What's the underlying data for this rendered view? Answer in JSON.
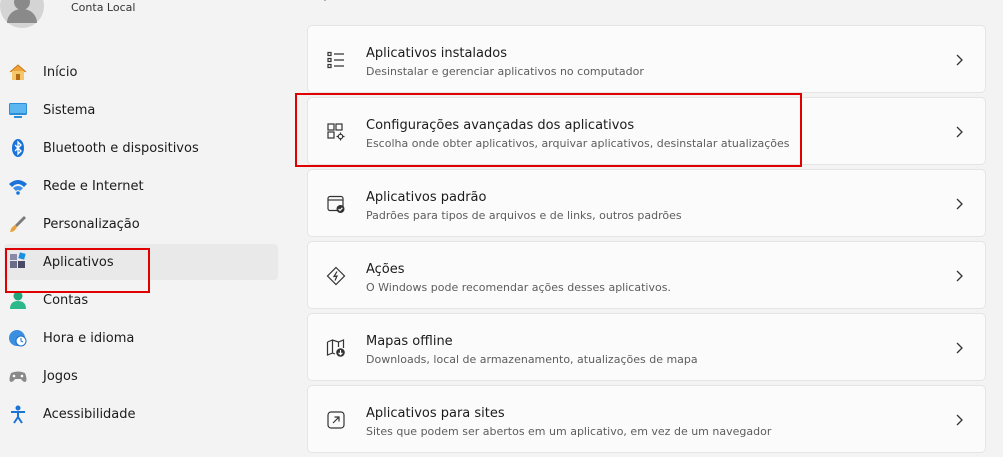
{
  "account": {
    "name": "Conta Local"
  },
  "sidebar": {
    "items": [
      {
        "label": "Início",
        "icon": "home-icon"
      },
      {
        "label": "Sistema",
        "icon": "system-icon"
      },
      {
        "label": "Bluetooth e dispositivos",
        "icon": "bluetooth-icon"
      },
      {
        "label": "Rede e Internet",
        "icon": "wifi-icon"
      },
      {
        "label": "Personalização",
        "icon": "brush-icon"
      },
      {
        "label": "Aplicativos",
        "icon": "apps-icon",
        "selected": true
      },
      {
        "label": "Contas",
        "icon": "person-icon"
      },
      {
        "label": "Hora e idioma",
        "icon": "clock-globe-icon"
      },
      {
        "label": "Jogos",
        "icon": "gamepad-icon"
      },
      {
        "label": "Acessibilidade",
        "icon": "accessibility-icon"
      }
    ]
  },
  "main": {
    "cards": [
      {
        "title": "Aplicativos instalados",
        "description": "Desinstalar e gerenciar aplicativos no computador",
        "icon": "list-icon"
      },
      {
        "title": "Configurações avançadas dos aplicativos",
        "description": "Escolha onde obter aplicativos, arquivar aplicativos, desinstalar atualizações",
        "icon": "app-settings-icon"
      },
      {
        "title": "Aplicativos padrão",
        "description": "Padrões para tipos de arquivos e de links, outros padrões",
        "icon": "default-apps-icon"
      },
      {
        "title": "Ações",
        "description": "O Windows pode recomendar ações desses aplicativos.",
        "icon": "actions-icon"
      },
      {
        "title": "Mapas offline",
        "description": "Downloads, local de armazenamento, atualizações de mapa",
        "icon": "map-download-icon"
      },
      {
        "title": "Aplicativos para sites",
        "description": "Sites que podem ser abertos em um aplicativo, em vez de um navegador",
        "icon": "open-external-icon"
      }
    ]
  },
  "colors": {
    "highlight": "#e00000",
    "accent": "#0067c0"
  }
}
